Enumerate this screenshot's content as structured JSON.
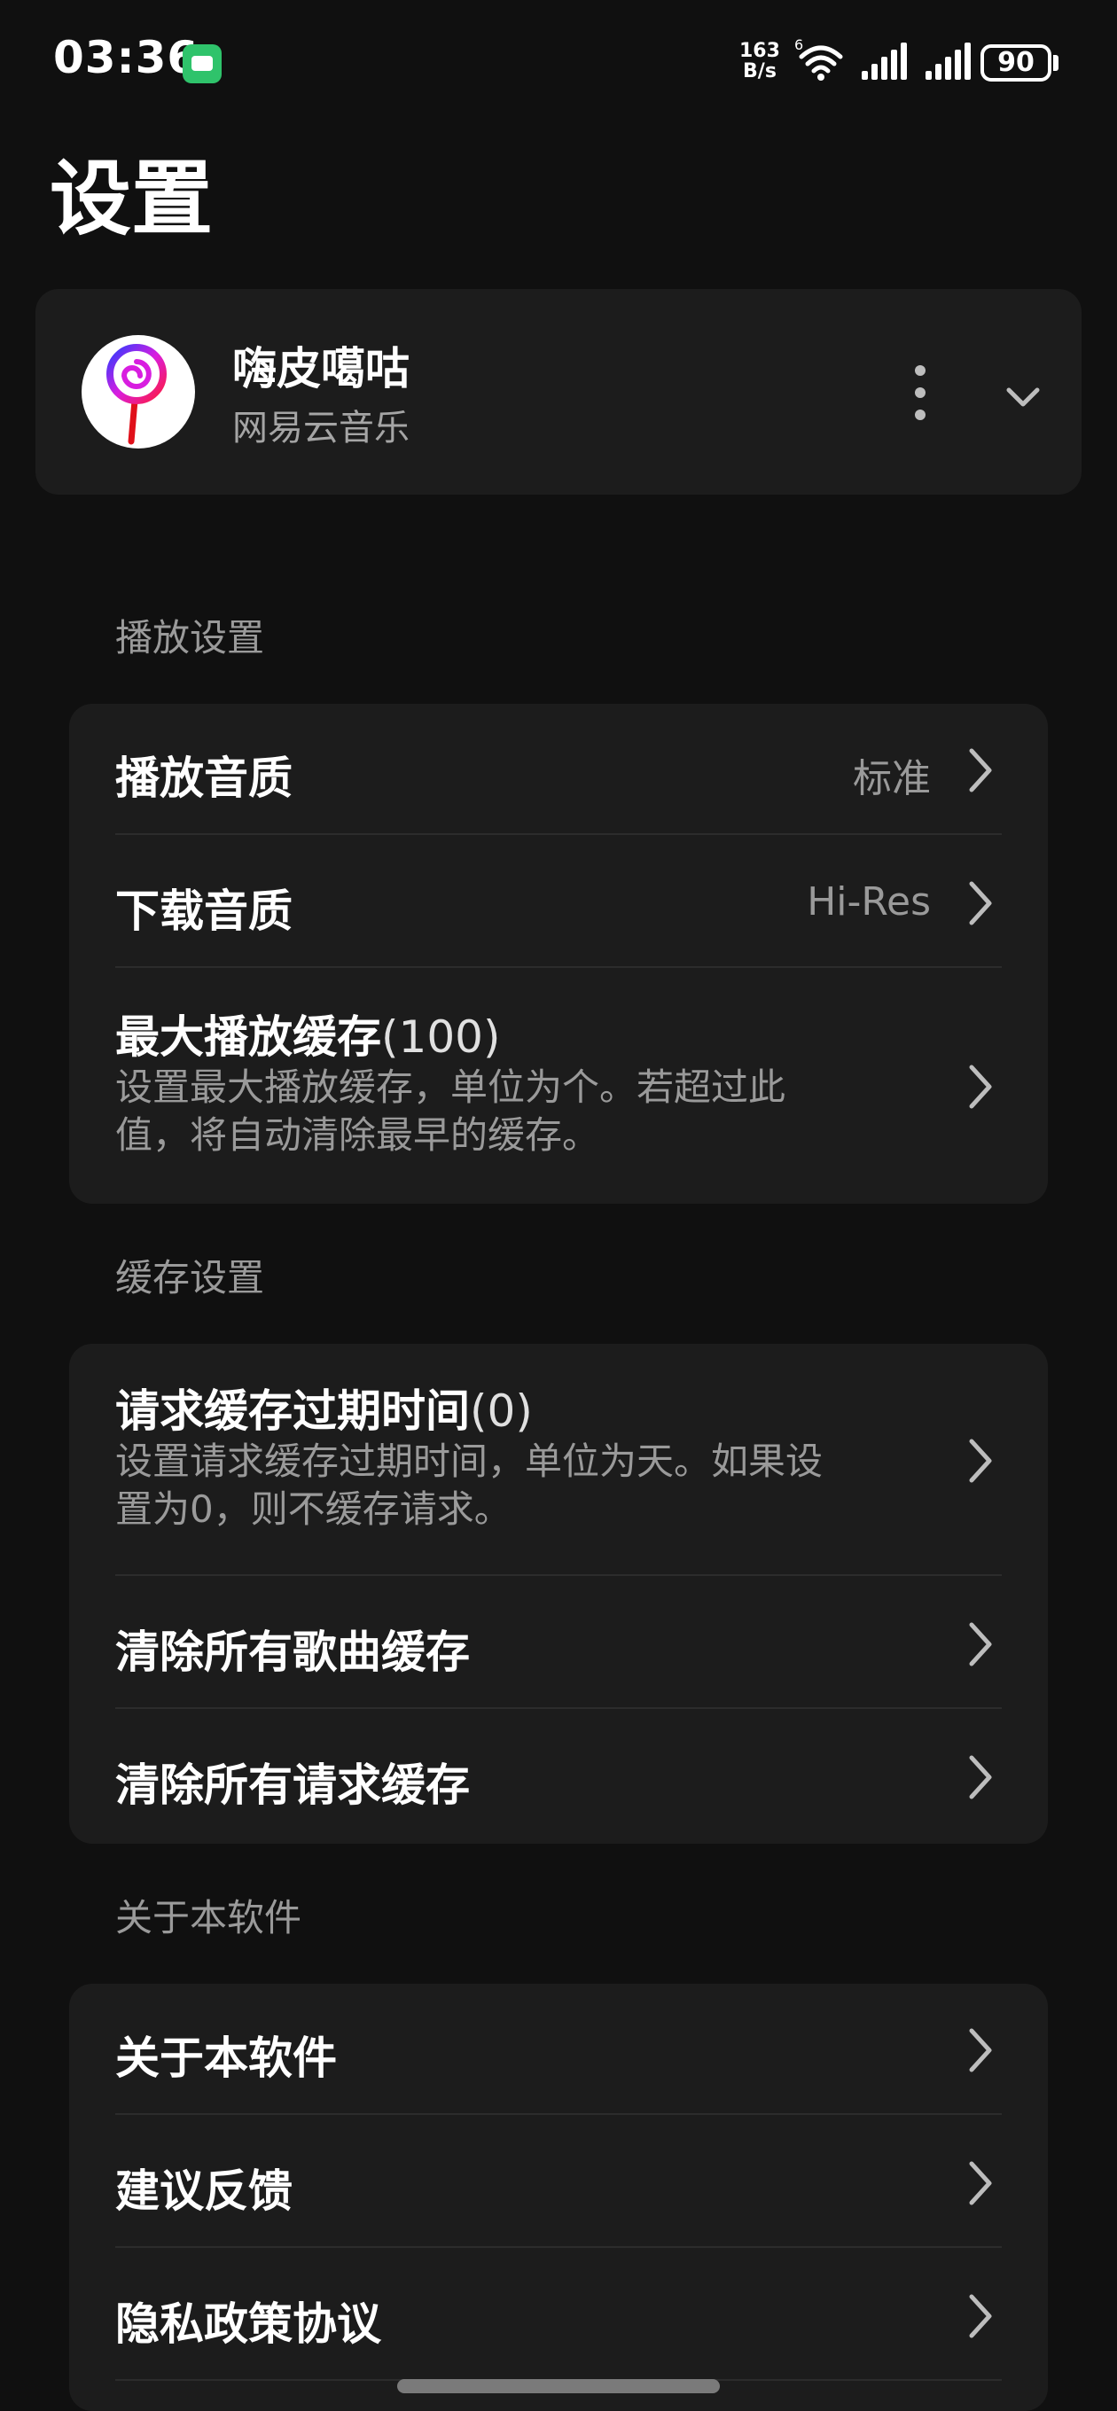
{
  "status_bar": {
    "time": "03:36",
    "net_speed_value": "163",
    "net_speed_unit": "B/s",
    "wifi_badge": "6",
    "battery": "90",
    "icons": [
      "app-notification-icon",
      "wifi-icon",
      "signal-icon",
      "signal-icon",
      "battery-icon"
    ]
  },
  "page": {
    "title": "设置"
  },
  "account": {
    "name": "嗨皮噶咕",
    "service": "网易云音乐"
  },
  "sections": {
    "playback": {
      "title": "播放设置",
      "quality": {
        "label": "播放音质",
        "value": "标准"
      },
      "download": {
        "label": "下载音质",
        "value": "Hi-Res"
      },
      "max_cache": {
        "label": "最大播放缓存",
        "count": "(100)",
        "desc": "设置最大播放缓存，单位为个。若超过此值，将自动清除最早的缓存。"
      }
    },
    "cache": {
      "title": "缓存设置",
      "expire": {
        "label": "请求缓存过期时间",
        "count": "(0)",
        "desc": "设置请求缓存过期时间，单位为天。如果设置为0，则不缓存请求。"
      },
      "clear_songs": {
        "label": "清除所有歌曲缓存"
      },
      "clear_requests": {
        "label": "清除所有请求缓存"
      }
    },
    "about": {
      "title": "关于本软件",
      "about_app": {
        "label": "关于本软件"
      },
      "feedback": {
        "label": "建议反馈"
      },
      "privacy": {
        "label": "隐私政策协议"
      }
    }
  },
  "colors": {
    "background": "#101010",
    "card": "#1c1c1c",
    "secondary_text": "#9a9a9a",
    "app_icon": "#2fc36b"
  }
}
